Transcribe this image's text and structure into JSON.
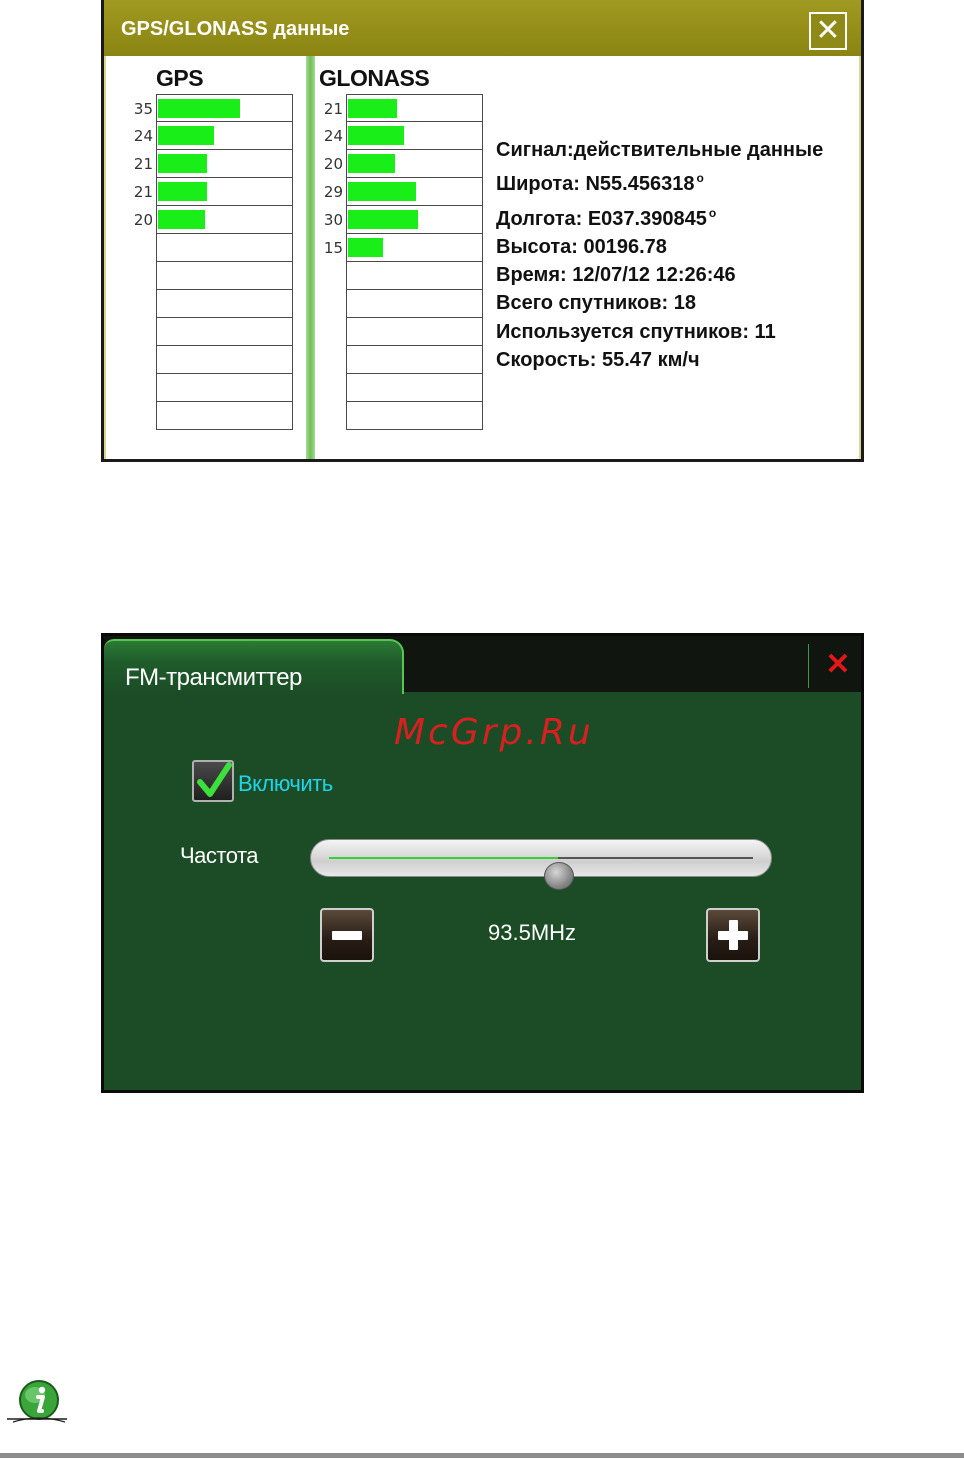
{
  "gps_window": {
    "title": "GPS/GLONASS данные",
    "close_symbol": "✕",
    "gps": {
      "header": "GPS",
      "satellites": [
        35,
        24,
        21,
        21,
        20
      ],
      "row_count": 12,
      "max_signal": 60
    },
    "glonass": {
      "header": "GLONASS",
      "satellites": [
        21,
        24,
        20,
        29,
        30,
        15
      ],
      "row_count": 12,
      "max_signal": 60
    },
    "info": {
      "signal": "Сигнал:действительные данные",
      "latitude": "Широта: N55.456318",
      "longitude": "Долгота: E037.390845",
      "degree_symbol": "o",
      "altitude": "Высота: 00196.78",
      "time": "Время: 12/07/12 12:26:46",
      "total_satellites": "Всего спутников: 18",
      "used_satellites": "Используется спутников: 11",
      "speed": "Скорость: 55.47 км/ч"
    }
  },
  "fm_window": {
    "title": "FM-трансмиттер",
    "close_symbol": "✕",
    "watermark": "McGrp.Ru",
    "enable": {
      "label": "Включить",
      "checked": true
    },
    "frequency": {
      "label": "Частота",
      "value": "93.5MHz",
      "slider_fraction": 0.54
    }
  },
  "icons": {
    "info": "info-icon",
    "check": "check-icon",
    "minus": "minus-icon",
    "plus": "plus-icon"
  },
  "colors": {
    "gps_titlebar": "#938d18",
    "signal_bar": "#19ee19",
    "fm_background": "#1b4c26",
    "fm_enable_text": "#22d3e8",
    "close_red": "#e01818"
  }
}
